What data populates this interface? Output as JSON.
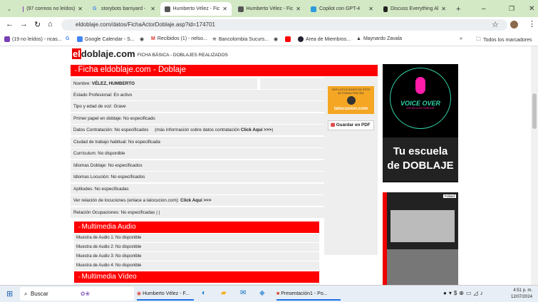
{
  "tabs": [
    {
      "label": "(97 correos no leídos)",
      "color": "#7b3fb5"
    },
    {
      "label": "storybots barnyard -",
      "color": "#4285f4"
    },
    {
      "label": "Humberto Vélez - Fic",
      "color": "#555",
      "active": true
    },
    {
      "label": "Humberto Vélez - Fic",
      "color": "#555"
    },
    {
      "label": "Copilot con GPT-4",
      "color": "#2d9cdb"
    },
    {
      "label": "Discuss Everything Al",
      "color": "#222"
    }
  ],
  "address": "eldoblaje.com/datos/FichaActorDoblaje.asp?id=174701",
  "bookmarks": [
    "(19 no leídos) - ncas...",
    "Google Calendar - S...",
    "Recibidos (1) - nelso...",
    "Bancolombia Sucurs...",
    "Area de Miembros...",
    "Maynardo Zavala",
    "Todos los marcadores"
  ],
  "logo": {
    "el": "el",
    "rest": "doblaje.com",
    "subtitle": "FICHA BÁSICA - DOBLAJES REALIZADOS"
  },
  "section_title": "Ficha eldoblaje.com - Doblaje",
  "fields": {
    "nombre_label": "Nombre:",
    "nombre": "VÉLEZ, HUMBERTO",
    "estado": "Estado Profesional: En activo",
    "tipo": "Tipo y edad de voz: Grave",
    "primer": "Primer papel en doblaje: No especificado",
    "datos": "Datos Contratación: No especificados",
    "datos_more": "(más información sobre datos contratación",
    "click": "Click Aquí >>>",
    "ciudad": "Ciudad de trabajo habitual: No especificada",
    "curriculum": "Currículum: No disponible",
    "idiomas_d": "Idiomas Doblaje: No especificados",
    "idiomas_l": "Idiomas Locución: No especificados",
    "aptitudes": "Aptitudes: No especificadas",
    "locuciones": "Ver relación de locuciones (enlace a lalocucion.com):",
    "click2": "Click Aquí >>>",
    "ocupaciones": "Relación Ocupaciones: No especificadas | |"
  },
  "lalocucion": {
    "top": "VER LOCUCIONES DE ESTE ACTOR/ACTRIZ EN:",
    "brand": "lalocucion.com"
  },
  "pdf_button": "Guardar en PDF",
  "audio_title": "Multimedia Audio",
  "audio": [
    "Muestra de Audio 1: No disponible",
    "Muestra de Audio 2: No disponible",
    "Muestra de Audio 3: No disponible",
    "Muestra de Audio 4: No disponible"
  ],
  "video_title": "Multimedia Vídeo",
  "ad1": {
    "title": "VOICE OVER",
    "sub": "ESCUELA DE DOBLAJE",
    "line1": "Tu escuela",
    "line2": "de DOBLAJE"
  },
  "ad2": {
    "badge": "Pollard"
  },
  "taskbar": {
    "search": "Buscar",
    "chrome": "Humberto Vélez - F...",
    "ppt": "Presentación1 - Po...",
    "time": "4:51 p. m.",
    "date": "12/07/2024"
  }
}
